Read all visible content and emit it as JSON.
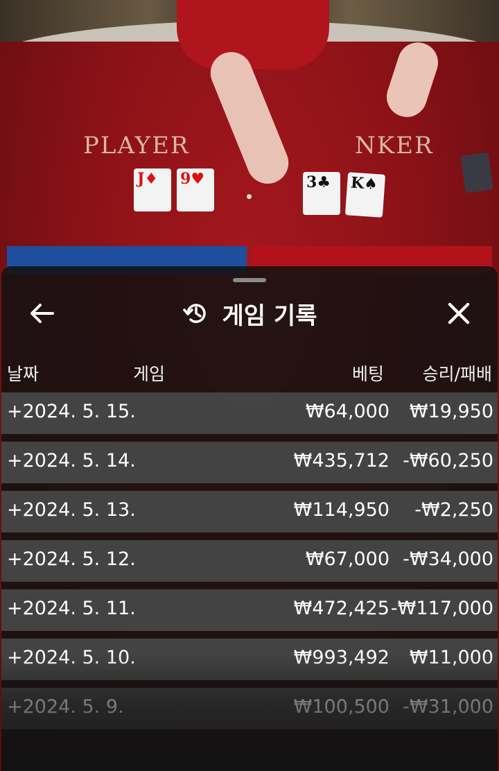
{
  "game_table": {
    "player_label": "PLAYER",
    "banker_label": "NKER",
    "player_cards": [
      {
        "rank": "J",
        "suit": "♦",
        "color": "red"
      },
      {
        "rank": "9",
        "suit": "♥",
        "color": "red"
      }
    ],
    "banker_cards": [
      {
        "rank": "3",
        "suit": "♣",
        "color": "black"
      },
      {
        "rank": "K",
        "suit": "♠",
        "color": "black"
      }
    ]
  },
  "sheet": {
    "title": "게임 기록",
    "icons": {
      "back": "arrow-left-icon",
      "history": "history-icon",
      "close": "close-icon"
    }
  },
  "table": {
    "columns": {
      "date": "날짜",
      "game": "게임",
      "bet": "베팅",
      "win_loss": "승리/패배"
    },
    "rows": [
      {
        "date": "+2024. 5. 15.",
        "bet": "₩64,000",
        "win_loss": "₩19,950"
      },
      {
        "date": "+2024. 5. 14.",
        "bet": "₩435,712",
        "win_loss": "-₩60,250"
      },
      {
        "date": "+2024. 5. 13.",
        "bet": "₩114,950",
        "win_loss": "-₩2,250"
      },
      {
        "date": "+2024. 5. 12.",
        "bet": "₩67,000",
        "win_loss": "-₩34,000"
      },
      {
        "date": "+2024. 5. 11.",
        "bet": "₩472,425",
        "win_loss": "-₩117,000"
      },
      {
        "date": "+2024. 5. 10.",
        "bet": "₩993,492",
        "win_loss": "₩11,000"
      },
      {
        "date": "+2024. 5. 9.",
        "bet": "₩100,500",
        "win_loss": "-₩31,000"
      }
    ]
  },
  "colors": {
    "sheet_bg": "#121212",
    "row_bg": "#484848",
    "text": "#ffffff",
    "felt": "#8c1217"
  }
}
